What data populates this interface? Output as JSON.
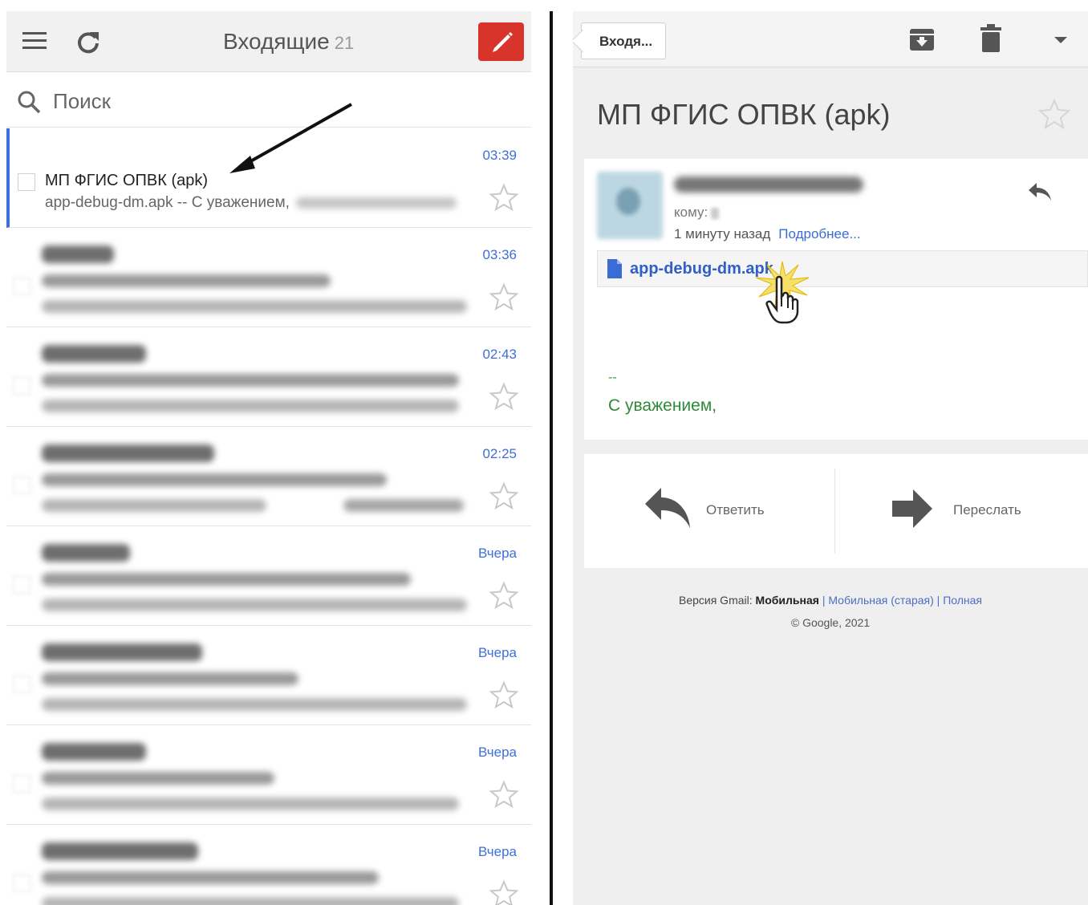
{
  "inbox": {
    "title": "Входящие",
    "count": "21",
    "search_placeholder": "Поиск",
    "first_email": {
      "subject": "МП  ФГИС ОПВК (apk)",
      "snippet": "app-debug-dm.apk -- С уважением,",
      "time": "03:39"
    },
    "other_times": [
      "03:36",
      "02:43",
      "02:25",
      "Вчера",
      "Вчера",
      "Вчера",
      "Вчера"
    ]
  },
  "message": {
    "back_label": "Входя...",
    "subject": "МП  ФГИС ОПВК (apk)",
    "to_label": "кому:",
    "time": "1 минуту назад",
    "details_link": "Подробнее...",
    "attachment": "app-debug-dm.apk",
    "signature_dash": "--",
    "signature": "С уважением,",
    "reply_label": "Ответить",
    "forward_label": "Переслать"
  },
  "footer": {
    "version_prefix": "Версия Gmail:",
    "current": "Мобильная",
    "sep": "|",
    "old_mobile": "Мобильная (старая)",
    "full": "Полная",
    "copyright": "© Google, 2021"
  },
  "colors": {
    "accent_blue": "#3e6fd8",
    "compose_red": "#d9342b",
    "signature_green": "#2e8a36"
  }
}
